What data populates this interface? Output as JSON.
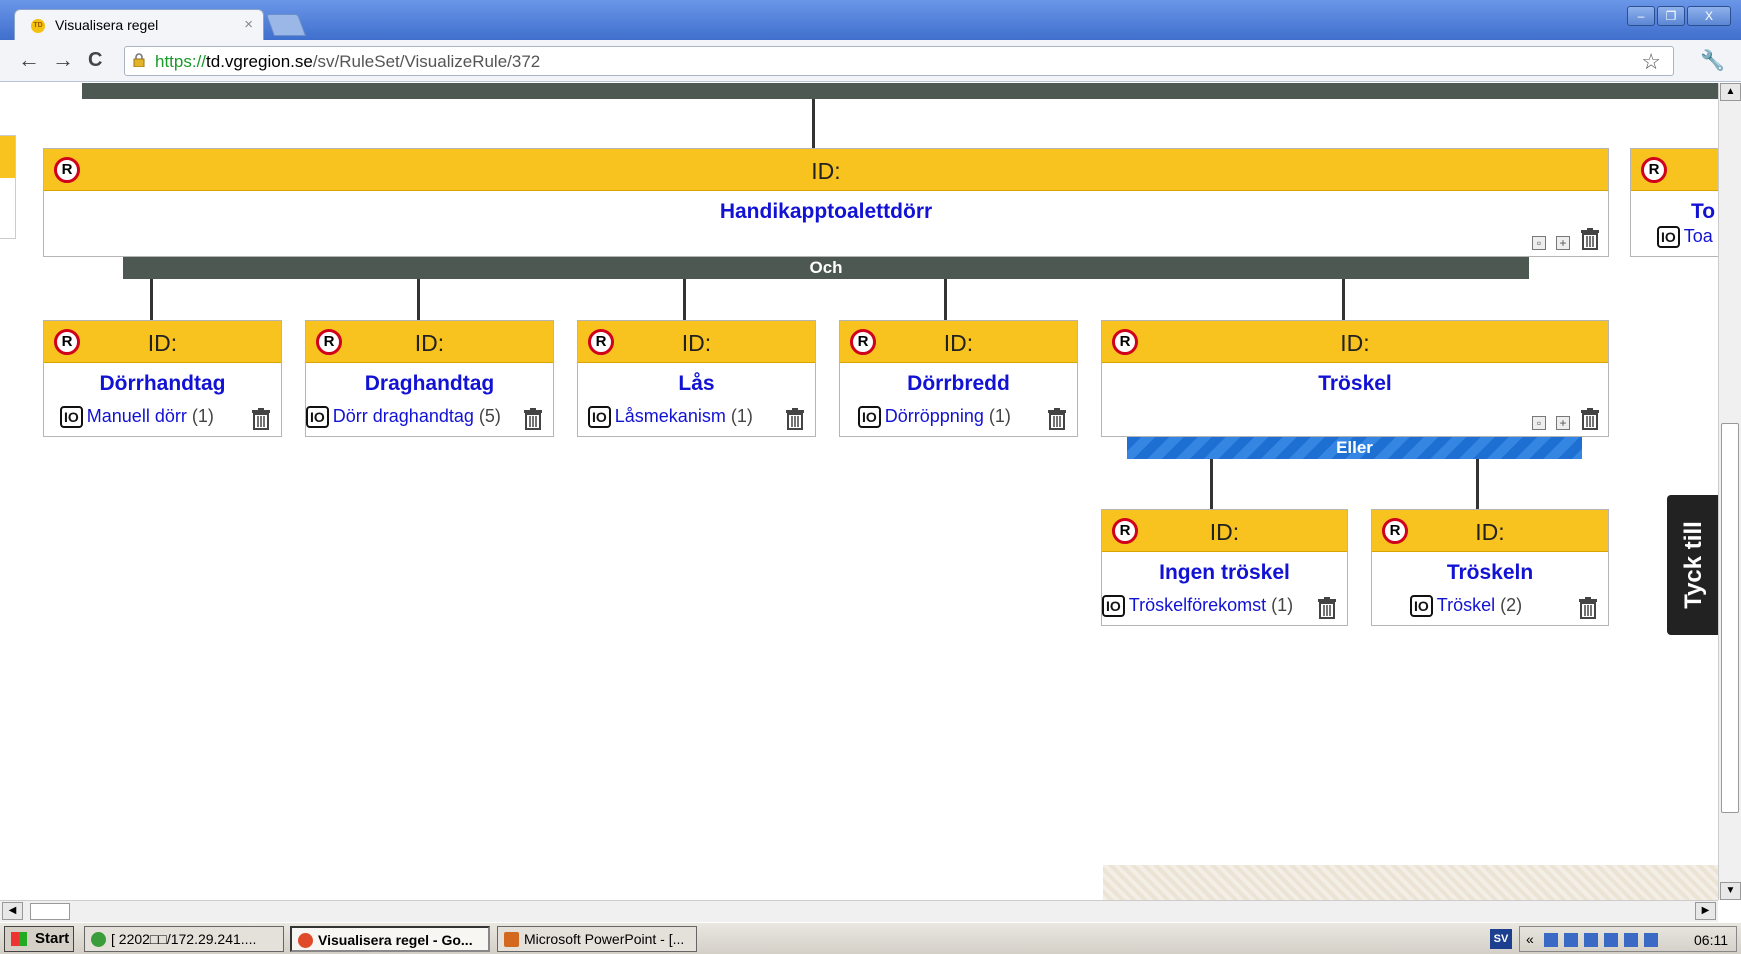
{
  "browser": {
    "tab_title": "Visualisera regel",
    "tab_close": "×",
    "url_scheme": "https://",
    "url_host": "td.vgregion.se",
    "url_path": "/sv/RuleSet/VisualizeRule/372",
    "back_icon": "←",
    "forward_icon": "→",
    "reload_icon": "C",
    "star_icon": "☆",
    "wrench_icon": "🔧",
    "win_minimize": "–",
    "win_restore": "❐",
    "win_close": "X"
  },
  "rule": {
    "badge": "R",
    "id_label": "ID:",
    "io_badge": "IO",
    "root": {
      "title": "Handikapptoalettdörr"
    },
    "right_partial": {
      "title": "To",
      "io_text": "Toa"
    },
    "connector_and": "Och",
    "connector_or": "Eller",
    "children": [
      {
        "title": "Dörrhandtag",
        "io_text": "Manuell dörr",
        "count": "(1)"
      },
      {
        "title": "Draghandtag",
        "io_text": "Dörr draghandtag",
        "count": "(5)"
      },
      {
        "title": "Lås",
        "io_text": "Låsmekanism",
        "count": "(1)"
      },
      {
        "title": "Dörrbredd",
        "io_text": "Dörröppning",
        "count": "(1)"
      },
      {
        "title": "Tröskel"
      }
    ],
    "grandchildren": [
      {
        "title": "Ingen tröskel",
        "io_text": "Tröskelförekomst",
        "count": "(1)"
      },
      {
        "title": "Tröskeln",
        "io_text": "Tröskel",
        "count": "(2)"
      }
    ]
  },
  "feedback": {
    "label": "Tyck till"
  },
  "taskbar": {
    "start": "Start",
    "items": [
      "[ 2202□□/172.29.241....",
      "Visualisera regel - Go...",
      "Microsoft PowerPoint - [..."
    ],
    "lang": "SV",
    "tray_arrow": "«",
    "clock": "06:11"
  }
}
